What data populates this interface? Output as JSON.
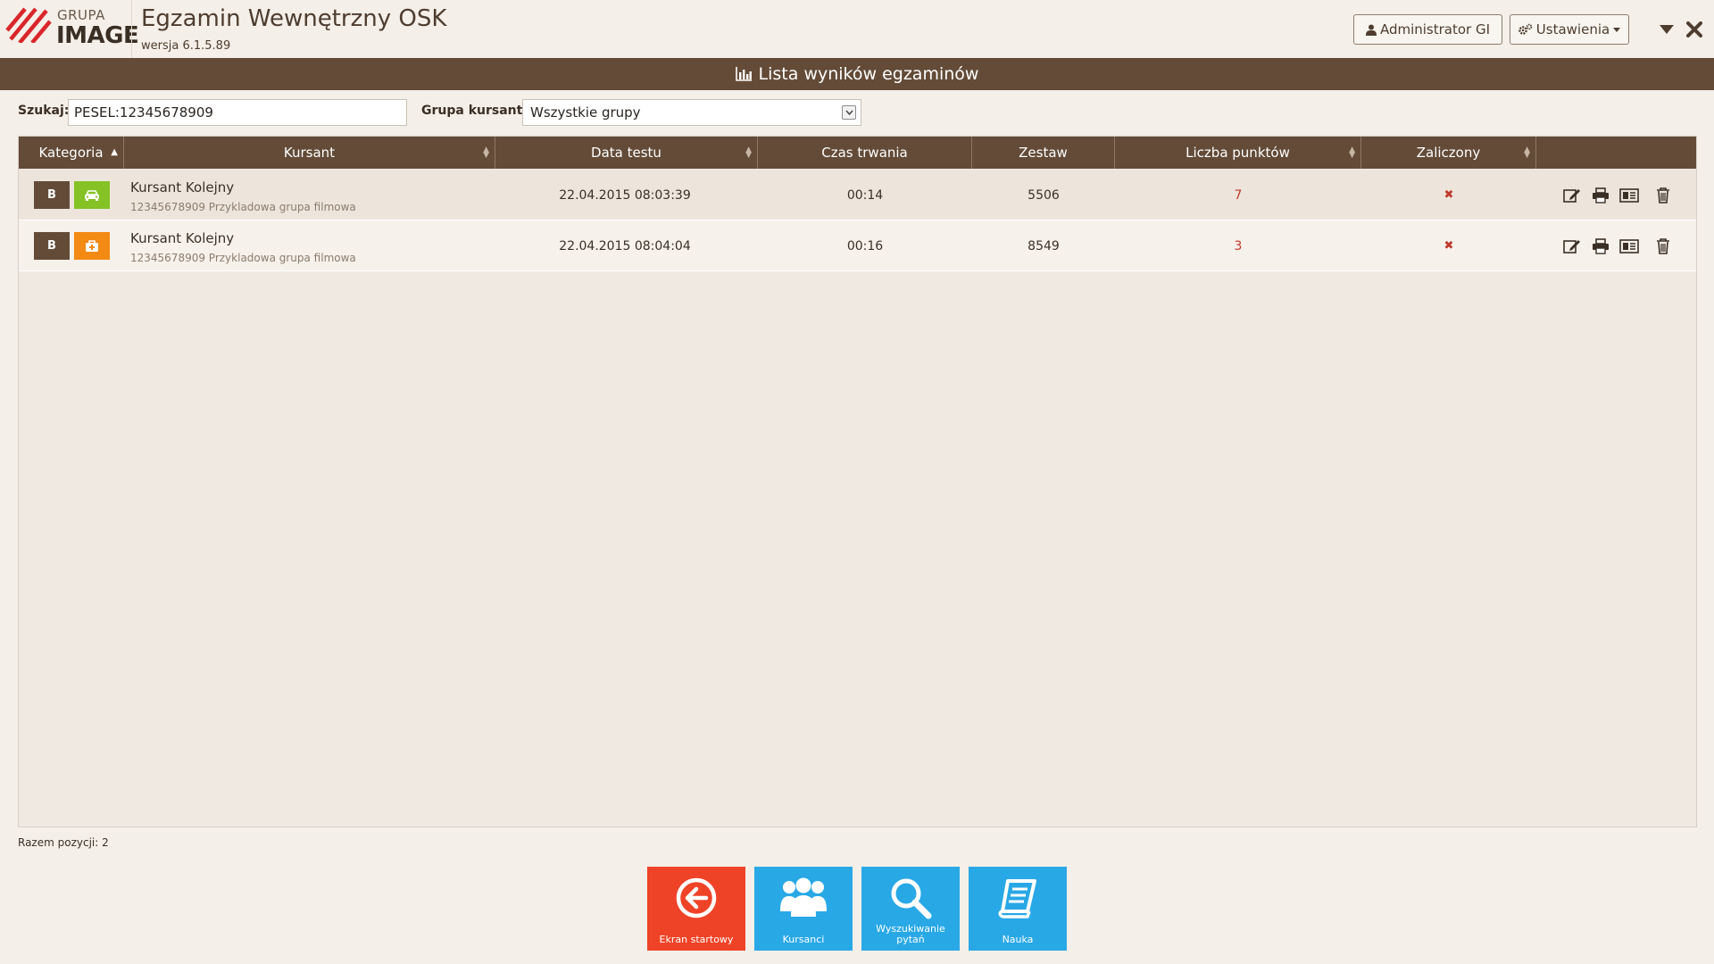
{
  "header": {
    "logo_small": "GRUPA",
    "logo_big": "IMAGE",
    "title": "Egzamin Wewnętrzny OSK",
    "version": "wersja 6.1.5.89",
    "user_button": "Administrator GI",
    "settings_button": "Ustawienia"
  },
  "page": {
    "title": "Lista wyników egzaminów"
  },
  "filters": {
    "search_label": "Szukaj:",
    "search_value": "PESEL:12345678909",
    "group_label": "Grupa kursanta:",
    "group_value": "Wszystkie grupy"
  },
  "table": {
    "columns": [
      "Kategoria",
      "Kursant",
      "Data testu",
      "Czas trwania",
      "Zestaw",
      "Liczba punktów",
      "Zaliczony",
      ""
    ],
    "rows": [
      {
        "category": "B",
        "type_icon": "car-icon",
        "name": "Kursant Kolejny",
        "sub": "12345678909 Przykladowa grupa filmowa",
        "date": "22.04.2015 08:03:39",
        "duration": "00:14",
        "set": "5506",
        "points": "7",
        "passed": "✖"
      },
      {
        "category": "B",
        "type_icon": "first-aid-kit-icon",
        "name": "Kursant Kolejny",
        "sub": "12345678909 Przykladowa grupa filmowa",
        "date": "22.04.2015 08:04:04",
        "duration": "00:16",
        "set": "8549",
        "points": "3",
        "passed": "✖"
      }
    ]
  },
  "footer": {
    "total": "Razem pozycji: 2"
  },
  "tiles": {
    "home": "Ekran startowy",
    "students": "Kursanci",
    "search_line1": "Wyszukiwanie",
    "search_line2": "pytań",
    "learn": "Nauka"
  },
  "colors": {
    "brand_brown": "#634b37",
    "background": "#f4efe8",
    "tile_red": "#ef4328",
    "tile_blue": "#29a8e6",
    "badge_green": "#84c225",
    "badge_orange": "#f28a14",
    "fail_red": "#c0392b"
  }
}
